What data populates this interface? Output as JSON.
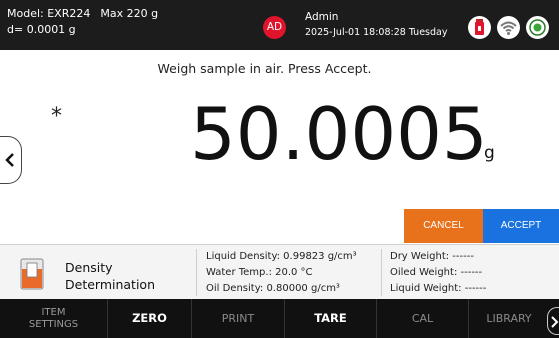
{
  "header": {
    "model": "Model: EXR224",
    "max": "Max 220 g",
    "readability": "d= 0.0001 g",
    "avatar_initials": "AD",
    "avatar_color": "#e0142b",
    "user_name": "Admin",
    "datetime": "2025-Jul-01 18:08:28 Tuesday",
    "icons": [
      "usb-drive-icon",
      "wifi-icon",
      "level-bubble-icon"
    ]
  },
  "main": {
    "prompt": "Weigh sample in air. Press Accept.",
    "stability_marker": "*",
    "weight_value": "50.0005",
    "unit": "g",
    "cancel_label": "CANCEL",
    "accept_label": "ACCEPT",
    "cancel_color": "#e8721c",
    "accept_color": "#1a72e0"
  },
  "info": {
    "mode_line1": "Density",
    "mode_line2": "Determination",
    "liquid_density": "Liquid Density: 0.99823 g/cm³",
    "water_temp": "Water Temp.: 20.0 °C",
    "oil_density": "Oil Density: 0.80000 g/cm³",
    "dry_weight": "Dry Weight: ------",
    "oiled_weight": "Oiled Weight: ------",
    "liquid_weight": "Liquid Weight: ------"
  },
  "toolbar": {
    "item_settings_l1": "ITEM",
    "item_settings_l2": "SETTINGS",
    "zero": "ZERO",
    "print": "PRINT",
    "tare": "TARE",
    "cal": "CAL",
    "library": "LIBRARY"
  }
}
